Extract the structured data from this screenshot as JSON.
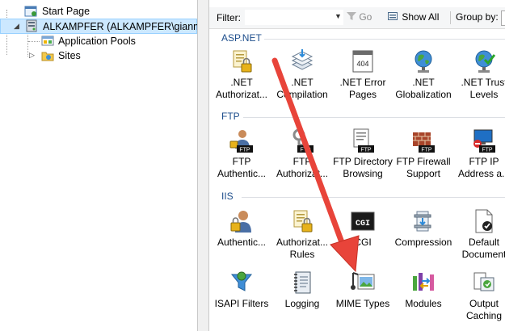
{
  "tree": {
    "start_page": "Start Page",
    "server": "ALKAMPFER (ALKAMPFER\\gianmar",
    "app_pools": "Application Pools",
    "sites": "Sites"
  },
  "filterbar": {
    "filter_label": "Filter:",
    "filter_value": "",
    "go_label": "Go",
    "show_all_label": "Show All",
    "group_by_label": "Group by:"
  },
  "sections": {
    "aspnet": "ASP.NET",
    "ftp": "FTP",
    "iis": "IIS"
  },
  "features": {
    "aspnet": [
      {
        "label": ".NET\nAuthorizat...",
        "icon": "authorization-icon"
      },
      {
        "label": ".NET\nCompilation",
        "icon": "compilation-icon"
      },
      {
        "label": ".NET Error\nPages",
        "icon": "error-pages-icon"
      },
      {
        "label": ".NET\nGlobalization",
        "icon": "globalization-icon"
      },
      {
        "label": ".NET Trust\nLevels",
        "icon": "trust-levels-icon"
      }
    ],
    "ftp": [
      {
        "label": "FTP\nAuthentic...",
        "icon": "ftp-authentication-icon"
      },
      {
        "label": "FTP\nAuthorizat...",
        "icon": "ftp-authorization-icon"
      },
      {
        "label": "FTP Directory\nBrowsing",
        "icon": "ftp-directory-browsing-icon"
      },
      {
        "label": "FTP Firewall\nSupport",
        "icon": "ftp-firewall-icon"
      },
      {
        "label": "FTP IP\nAddress a...",
        "icon": "ftp-ip-address-icon"
      }
    ],
    "iis_row1": [
      {
        "label": "Authentic...",
        "icon": "authentication-icon"
      },
      {
        "label": "Authorizat...\nRules",
        "icon": "authorization-rules-icon"
      },
      {
        "label": "CGI",
        "icon": "cgi-icon",
        "icon_text": "CGI"
      },
      {
        "label": "Compression",
        "icon": "compression-icon"
      },
      {
        "label": "Default\nDocument",
        "icon": "default-document-icon"
      }
    ],
    "iis_row2": [
      {
        "label": "ISAPI Filters",
        "icon": "isapi-filters-icon"
      },
      {
        "label": "Logging",
        "icon": "logging-icon"
      },
      {
        "label": "MIME Types",
        "icon": "mime-types-icon"
      },
      {
        "label": "Modules",
        "icon": "modules-icon"
      },
      {
        "label": "Output\nCaching",
        "icon": "output-caching-icon"
      }
    ]
  },
  "badges": {
    "ftp": "FTP",
    "error_code": "404"
  },
  "colors": {
    "section_title": "#1e4e8c",
    "selection_bg": "#cce8ff",
    "arrow": "#e8443a"
  }
}
